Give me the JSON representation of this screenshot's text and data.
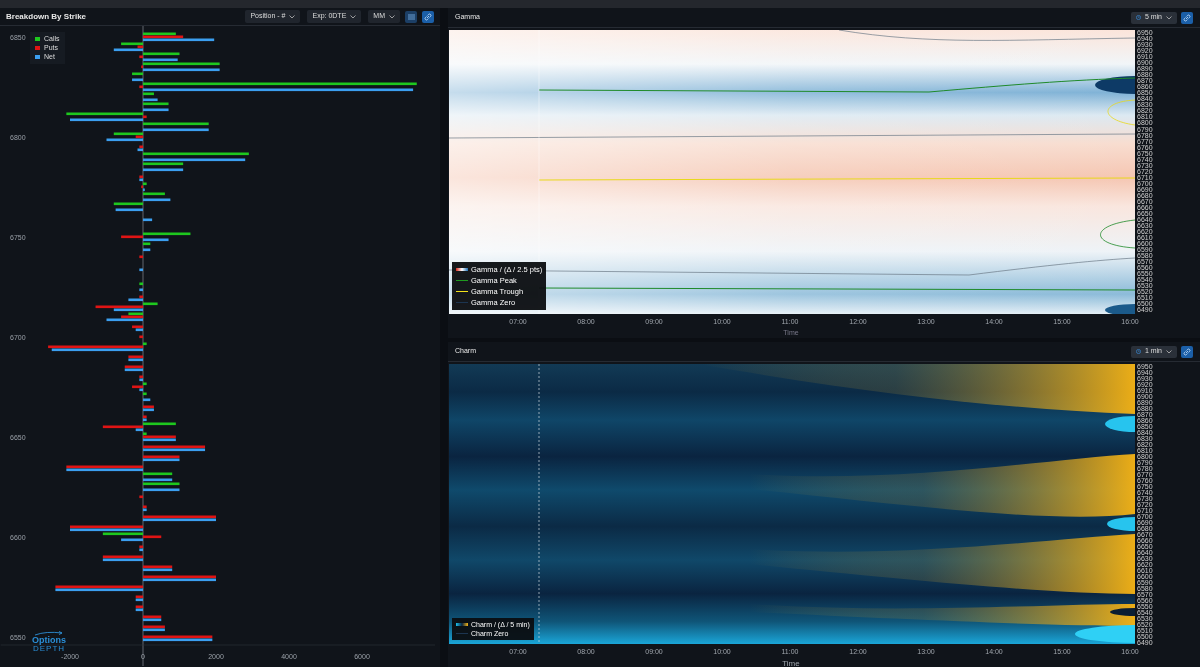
{
  "breakdown": {
    "title": "Breakdown By Strike",
    "controls": [
      {
        "kind": "dropdown",
        "label": "Position - #"
      },
      {
        "kind": "dropdown",
        "label": "Exp: 0DTE"
      },
      {
        "kind": "dropdown",
        "label": "MM"
      },
      {
        "kind": "list"
      },
      {
        "kind": "link"
      }
    ],
    "logo": {
      "name": "Options",
      "tagline": "DEPTH"
    },
    "chart_data": {
      "type": "bar",
      "orientation": "horizontal",
      "legend": "upper left",
      "x": [
        6850,
        6845,
        6840,
        6835,
        6830,
        6825,
        6820,
        6815,
        6810,
        6805,
        6800,
        6795,
        6790,
        6785,
        6780,
        6775,
        6770,
        6765,
        6760,
        6755,
        6750,
        6745,
        6740,
        6735,
        6730,
        6725,
        6720,
        6715,
        6710,
        6705,
        6700,
        6695,
        6690,
        6685,
        6680,
        6675,
        6670,
        6665,
        6660,
        6655,
        6650,
        6645,
        6640,
        6635,
        6630,
        6625,
        6620,
        6615,
        6610,
        6605,
        6600,
        6595,
        6590,
        6585,
        6580,
        6575,
        6570,
        6565,
        6560,
        6555,
        6550
      ],
      "xlim": [
        -3900,
        8000
      ],
      "ylim": [
        6535,
        6864
      ],
      "series": [
        {
          "name": "Calls",
          "color": "#1ec81e",
          "values": [
            900,
            -600,
            1000,
            2100,
            -300,
            7500,
            300,
            700,
            -2100,
            1800,
            -800,
            0,
            2900,
            1100,
            0,
            100,
            600,
            -800,
            0,
            0,
            1300,
            200,
            0,
            0,
            0,
            -100,
            0,
            400,
            -400,
            0,
            0,
            100,
            0,
            0,
            0,
            100,
            100,
            0,
            0,
            900,
            100,
            0,
            0,
            0,
            800,
            1000,
            0,
            0,
            0,
            0,
            -1100,
            0,
            0,
            0,
            0,
            0,
            0,
            0,
            0,
            0,
            0
          ]
        },
        {
          "name": "Puts",
          "color": "#e01414",
          "values": [
            1100,
            -150,
            -100,
            -50,
            0,
            -100,
            0,
            0,
            100,
            0,
            -200,
            -100,
            0,
            0,
            -100,
            -50,
            0,
            0,
            0,
            0,
            -600,
            0,
            -100,
            0,
            0,
            0,
            -100,
            -1300,
            -600,
            -300,
            -100,
            -2600,
            -400,
            -500,
            -100,
            -300,
            0,
            300,
            100,
            -1100,
            900,
            1700,
            1000,
            -2100,
            0,
            0,
            -100,
            100,
            2000,
            -2000,
            500,
            -100,
            -1100,
            800,
            2000,
            -2400,
            -200,
            -200,
            500,
            600,
            1900
          ]
        },
        {
          "name": "Net",
          "color": "#3b9ff0",
          "values": [
            1950,
            -800,
            950,
            2100,
            -300,
            7400,
            400,
            700,
            -2000,
            1800,
            -1000,
            -150,
            2800,
            1100,
            -100,
            50,
            750,
            -750,
            250,
            0,
            700,
            200,
            0,
            -100,
            0,
            -100,
            -400,
            -800,
            -1000,
            -200,
            0,
            -2500,
            -400,
            -500,
            -100,
            -100,
            200,
            300,
            100,
            -200,
            900,
            1700,
            1000,
            -2100,
            800,
            1000,
            0,
            100,
            2000,
            -2000,
            -600,
            -100,
            -1100,
            800,
            2000,
            -2400,
            -200,
            -200,
            500,
            600,
            1900
          ]
        }
      ],
      "xticks": [
        -2000,
        0,
        2000,
        4000,
        6000
      ],
      "yticks": [
        6850,
        6800,
        6750,
        6700,
        6650,
        6600,
        6550
      ]
    }
  },
  "gamma": {
    "title": "Gamma",
    "interval": "5 min",
    "legend": [
      {
        "kind": "gradient",
        "label": "Gamma / (Δ / 2.5 pts)"
      },
      {
        "kind": "line",
        "label": "Gamma Peak",
        "color": "#1f9a1f"
      },
      {
        "kind": "line",
        "label": "Gamma Trough",
        "color": "#f2e21a"
      },
      {
        "kind": "line",
        "label": "Gamma Zero",
        "color": "#1c3550"
      }
    ],
    "price_labels": [
      "6950",
      "6940",
      "6930",
      "6920",
      "6910",
      "6900",
      "6890",
      "6880",
      "6870",
      "6860",
      "6850",
      "6840",
      "6830",
      "6820",
      "6810",
      "6800",
      "6790",
      "6780",
      "6770",
      "6760",
      "6750",
      "6740",
      "6730",
      "6720",
      "6710",
      "6700",
      "6690",
      "6680",
      "6670",
      "6660",
      "6650",
      "6640",
      "6630",
      "6620",
      "6610",
      "6600",
      "6590",
      "6580",
      "6570",
      "6560",
      "6550",
      "6540",
      "6530",
      "6520",
      "6510",
      "6500",
      "6490"
    ],
    "time_labels": [
      "07:00",
      "08:00",
      "09:00",
      "10:00",
      "11:00",
      "12:00",
      "13:00",
      "14:00",
      "15:00",
      "16:00"
    ],
    "xlabel": "Time"
  },
  "charm": {
    "title": "Charm",
    "interval": "1 min",
    "legend": [
      {
        "kind": "gradient",
        "label": "Charm / (Δ / 5 min)"
      },
      {
        "kind": "line",
        "label": "Charm Zero",
        "color": "#1c3550"
      }
    ],
    "price_labels": [
      "6950",
      "6940",
      "6930",
      "6920",
      "6910",
      "6900",
      "6890",
      "6880",
      "6870",
      "6860",
      "6850",
      "6840",
      "6830",
      "6820",
      "6810",
      "6800",
      "6790",
      "6780",
      "6770",
      "6760",
      "6750",
      "6740",
      "6730",
      "6720",
      "6710",
      "6700",
      "6690",
      "6680",
      "6670",
      "6660",
      "6650",
      "6640",
      "6630",
      "6620",
      "6610",
      "6600",
      "6590",
      "6580",
      "6570",
      "6560",
      "6550",
      "6540",
      "6530",
      "6520",
      "6510",
      "6500",
      "6490"
    ],
    "time_labels": [
      "07:00",
      "08:00",
      "09:00",
      "10:00",
      "11:00",
      "12:00",
      "13:00",
      "14:00",
      "15:00",
      "16:00"
    ],
    "xlabel": "Time"
  }
}
